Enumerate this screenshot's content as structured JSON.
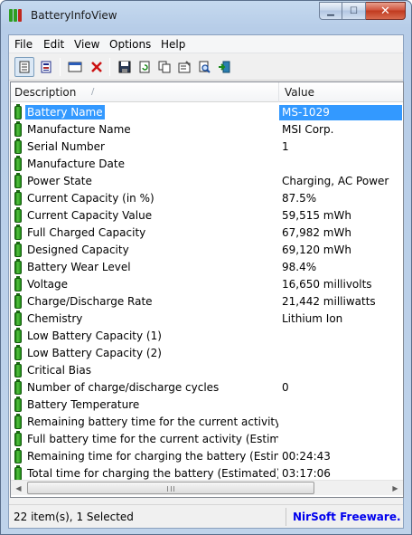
{
  "window": {
    "title": "BatteryInfoView"
  },
  "menu": [
    "File",
    "Edit",
    "View",
    "Options",
    "Help"
  ],
  "toolbar": {
    "icons": [
      "properties-icon",
      "html-report-icon",
      "select-all-icon",
      "delete-icon",
      "save-icon",
      "refresh-icon",
      "copy-icon",
      "properties-dialog-icon",
      "find-icon",
      "exit-icon"
    ]
  },
  "columns": {
    "description": "Description",
    "value": "Value"
  },
  "rows": [
    {
      "description": "Battery Name",
      "value": "MS-1029"
    },
    {
      "description": "Manufacture Name",
      "value": "MSI Corp."
    },
    {
      "description": "Serial Number",
      "value": "1"
    },
    {
      "description": "Manufacture Date",
      "value": ""
    },
    {
      "description": "Power State",
      "value": "Charging, AC Power"
    },
    {
      "description": "Current Capacity (in %)",
      "value": "87.5%"
    },
    {
      "description": "Current Capacity Value",
      "value": "59,515 mWh"
    },
    {
      "description": "Full Charged Capacity",
      "value": "67,982 mWh"
    },
    {
      "description": "Designed Capacity",
      "value": "69,120 mWh"
    },
    {
      "description": "Battery Wear Level",
      "value": "98.4%"
    },
    {
      "description": "Voltage",
      "value": "16,650 millivolts"
    },
    {
      "description": "Charge/Discharge Rate",
      "value": "21,442 milliwatts"
    },
    {
      "description": "Chemistry",
      "value": "Lithium Ion"
    },
    {
      "description": "Low Battery Capacity (1)",
      "value": ""
    },
    {
      "description": "Low Battery Capacity (2)",
      "value": ""
    },
    {
      "description": "Critical Bias",
      "value": ""
    },
    {
      "description": "Number of charge/discharge cycles",
      "value": "0"
    },
    {
      "description": "Battery Temperature",
      "value": ""
    },
    {
      "description": "Remaining battery time for the current activity (Est...",
      "value": ""
    },
    {
      "description": "Full battery time for the current activity (Estimated)",
      "value": ""
    },
    {
      "description": "Remaining time for charging the battery (Estimated)",
      "value": "00:24:43"
    },
    {
      "description": "Total  time for charging the battery (Estimated)",
      "value": "03:17:06"
    }
  ],
  "selected_row": 0,
  "status": {
    "count": "22 item(s), 1 Selected",
    "credit": "NirSoft Freeware.  htt"
  },
  "colors": {
    "selection": "#3399ff",
    "battery_icon": "#2f9e22",
    "credit_link": "#0000ee"
  }
}
